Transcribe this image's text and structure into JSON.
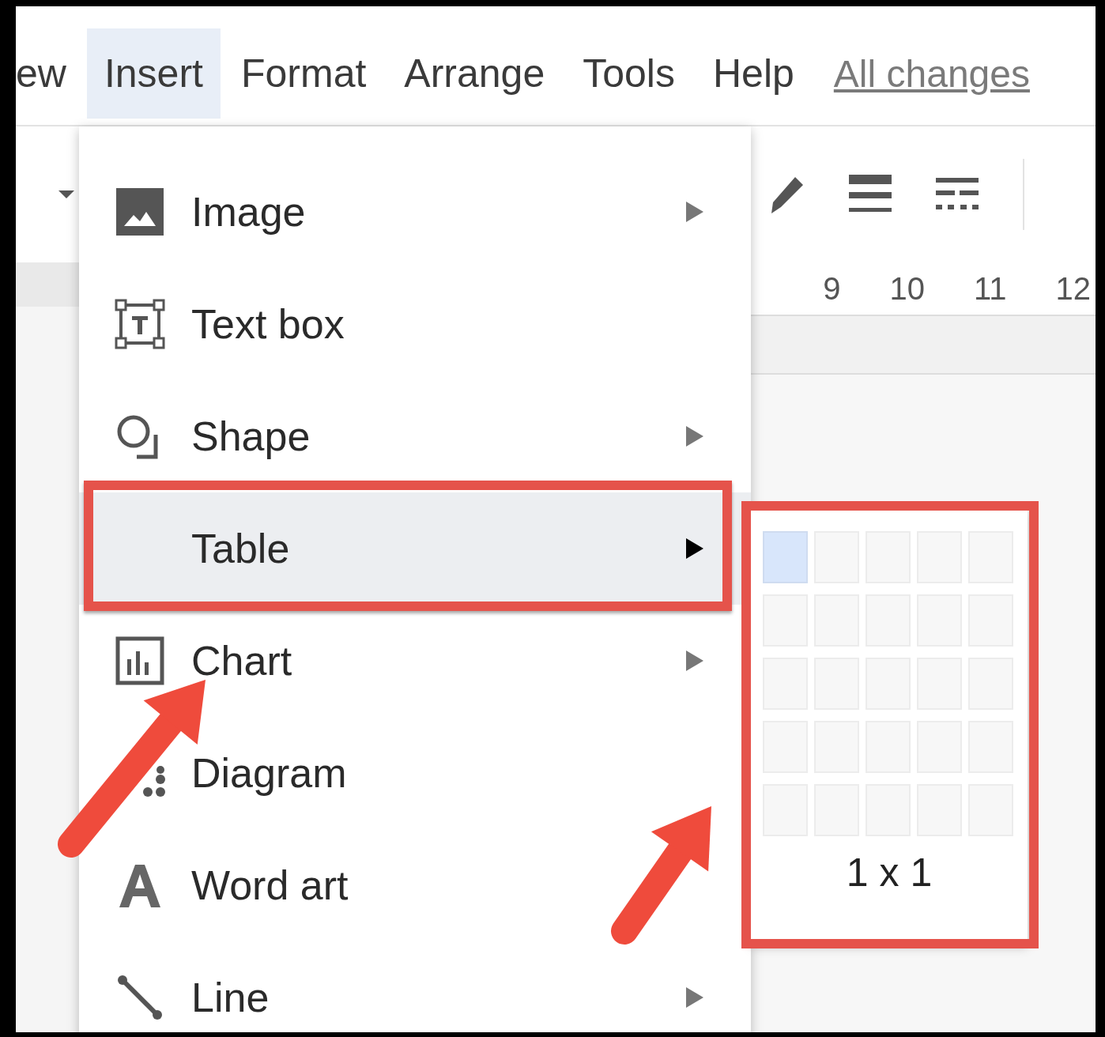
{
  "menu_bar": [
    {
      "label": "ew",
      "selected": false
    },
    {
      "label": "Insert",
      "selected": true
    },
    {
      "label": "Format",
      "selected": false
    },
    {
      "label": "Arrange",
      "selected": false
    },
    {
      "label": "Tools",
      "selected": false
    },
    {
      "label": "Help",
      "selected": false
    }
  ],
  "save_status": "All changes",
  "ruler": [
    "9",
    "10",
    "11",
    "12"
  ],
  "insert_menu": [
    {
      "label": "Image",
      "kind": "image",
      "has_submenu": true,
      "selected": false
    },
    {
      "label": "Text box",
      "kind": "textbox",
      "has_submenu": false,
      "selected": false
    },
    {
      "label": "Shape",
      "kind": "shape",
      "has_submenu": true,
      "selected": false
    },
    {
      "label": "Table",
      "kind": "plain",
      "has_submenu": true,
      "selected": true
    },
    {
      "label": "Chart",
      "kind": "chart",
      "has_submenu": true,
      "selected": false
    },
    {
      "label": "Diagram",
      "kind": "diagram",
      "has_submenu": false,
      "selected": false
    },
    {
      "label": "Word art",
      "kind": "wordart",
      "has_submenu": false,
      "selected": false
    },
    {
      "label": "Line",
      "kind": "line",
      "has_submenu": true,
      "selected": false
    }
  ],
  "table_picker": {
    "cells": [
      [
        {
          "selected": true
        },
        {
          "selected": false
        },
        {
          "selected": false
        },
        {
          "selected": false
        },
        {
          "selected": false
        }
      ],
      [
        {
          "selected": false
        },
        {
          "selected": false
        },
        {
          "selected": false
        },
        {
          "selected": false
        },
        {
          "selected": false
        }
      ],
      [
        {
          "selected": false
        },
        {
          "selected": false
        },
        {
          "selected": false
        },
        {
          "selected": false
        },
        {
          "selected": false
        }
      ],
      [
        {
          "selected": false
        },
        {
          "selected": false
        },
        {
          "selected": false
        },
        {
          "selected": false
        },
        {
          "selected": false
        }
      ],
      [
        {
          "selected": false
        },
        {
          "selected": false
        },
        {
          "selected": false
        },
        {
          "selected": false
        },
        {
          "selected": false
        }
      ]
    ],
    "size": "1 x 1"
  }
}
